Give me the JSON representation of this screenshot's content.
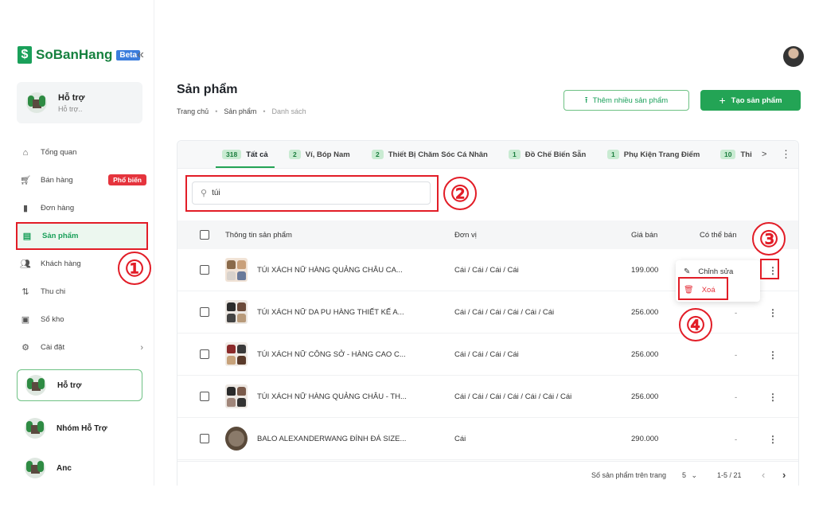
{
  "app": {
    "name": "SoBanHang",
    "beta": "Beta",
    "collapse_icon": "double-chevron-left-icon",
    "brand_color": "#16813f"
  },
  "support": {
    "title": "Hỗ trợ",
    "subtitle": "Hỗ trợ.."
  },
  "nav": [
    {
      "label": "Tổng quan",
      "icon": "home-icon"
    },
    {
      "label": "Bán hàng",
      "icon": "cart-icon",
      "badge": "Phổ biến"
    },
    {
      "label": "Đơn hàng",
      "icon": "file-icon"
    },
    {
      "label": "Sản phẩm",
      "icon": "box-icon",
      "active": true
    },
    {
      "label": "Khách hàng",
      "icon": "users-icon"
    },
    {
      "label": "Thu chi",
      "icon": "transfer-icon"
    },
    {
      "label": "Sổ kho",
      "icon": "warehouse-icon"
    },
    {
      "label": "Cài đặt",
      "icon": "gear-icon",
      "chevron": "›"
    }
  ],
  "shops": [
    {
      "name": "Hỗ trợ"
    },
    {
      "name": "Nhóm Hỗ Trợ"
    },
    {
      "name": "Anc"
    }
  ],
  "header": {
    "title": "Sản phẩm",
    "breadcrumb": [
      "Trang chủ",
      "Sản phẩm",
      "Danh sách"
    ],
    "import_label": "Thêm nhiều sản phẩm",
    "create_label": "Tạo sản phẩm"
  },
  "tabs": [
    {
      "count": "318",
      "label": "Tất cả"
    },
    {
      "count": "2",
      "label": "Ví, Bóp Nam"
    },
    {
      "count": "2",
      "label": "Thiết Bị Chăm Sóc Cá Nhân"
    },
    {
      "count": "1",
      "label": "Đồ Chế Biến Sẵn"
    },
    {
      "count": "1",
      "label": "Phụ Kiện Trang Điểm"
    },
    {
      "count": "10",
      "label": "Thi"
    }
  ],
  "tab_next": ">",
  "search": {
    "value": "túi",
    "icon": "search-icon"
  },
  "table": {
    "columns": [
      "Thông tin sản phẩm",
      "Đơn vị",
      "Giá bán",
      "Có thể bán"
    ],
    "rows": [
      {
        "name": "TÚI XÁCH NỮ HÀNG QUẢNG CHÂU CA...",
        "unit": "Cái / Cái / Cái / Cái",
        "price": "199.000",
        "available": "-"
      },
      {
        "name": "TÚI XÁCH NỮ DA PU HÀNG THIẾT KẾ A...",
        "unit": "Cái / Cái / Cái / Cái / Cái / Cái",
        "price": "256.000",
        "available": "-"
      },
      {
        "name": "TÚI XÁCH NỮ CÔNG SỞ - HÀNG CAO C...",
        "unit": "Cái / Cái / Cái / Cái",
        "price": "256.000",
        "available": "-"
      },
      {
        "name": "TÚI XÁCH NỮ HÀNG QUẢNG CHÂU - TH...",
        "unit": "Cái / Cái / Cái / Cái / Cái / Cái / Cái",
        "price": "256.000",
        "available": "-"
      },
      {
        "name": "BALO ALEXANDERWANG ĐÍNH ĐÁ SIZE...",
        "unit": "Cái",
        "price": "290.000",
        "available": "-"
      }
    ]
  },
  "dropdown": {
    "edit": "Chỉnh sửa",
    "delete": "Xoá"
  },
  "pagination": {
    "per_page_label": "Số sản phẩm trên trang",
    "per_page": "5",
    "range": "1-5 / 21",
    "prev": "‹",
    "next": "›"
  },
  "annotations": {
    "n1": "①",
    "n2": "②",
    "n3": "③",
    "n4": "④"
  }
}
